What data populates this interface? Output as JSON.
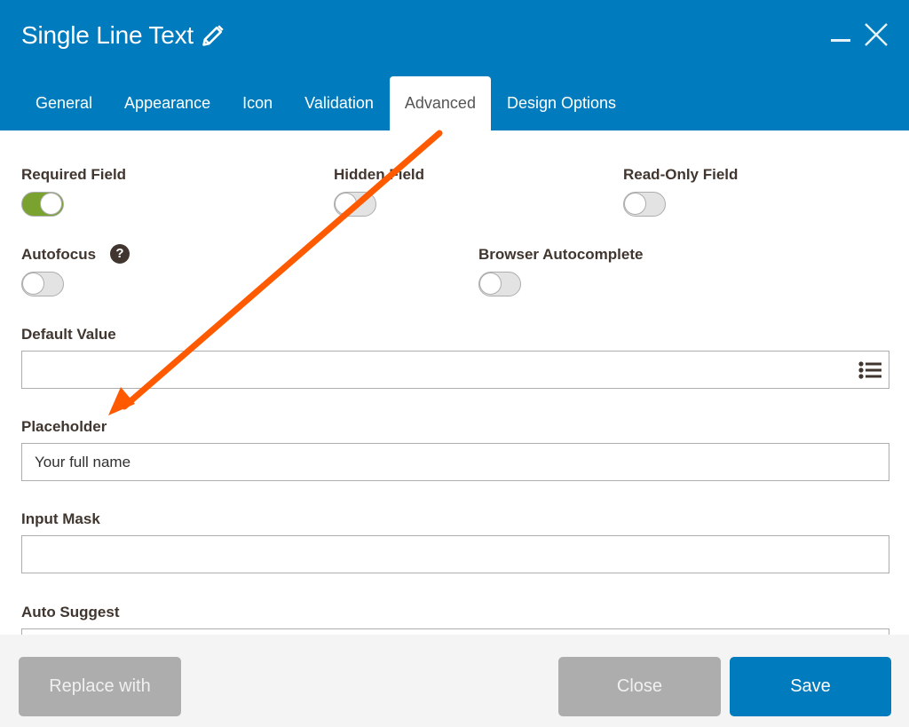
{
  "header": {
    "title": "Single Line Text",
    "edit_icon": "pencil-icon",
    "minimize_icon": "minimize-icon",
    "close_icon": "close-icon"
  },
  "tabs": [
    {
      "label": "General",
      "active": false
    },
    {
      "label": "Appearance",
      "active": false
    },
    {
      "label": "Icon",
      "active": false
    },
    {
      "label": "Validation",
      "active": false
    },
    {
      "label": "Advanced",
      "active": true
    },
    {
      "label": "Design Options",
      "active": false
    }
  ],
  "toggles": {
    "required_field": {
      "label": "Required Field",
      "on": true
    },
    "hidden_field": {
      "label": "Hidden Field",
      "on": false
    },
    "read_only_field": {
      "label": "Read-Only Field",
      "on": false
    },
    "autofocus": {
      "label": "Autofocus",
      "on": false,
      "help_icon": "question-circle-icon"
    },
    "browser_autocomplete": {
      "label": "Browser Autocomplete",
      "on": false
    }
  },
  "fields": {
    "default_value": {
      "label": "Default Value",
      "value": "",
      "icon": "list-icon"
    },
    "placeholder": {
      "label": "Placeholder",
      "value": "Your full name"
    },
    "input_mask": {
      "label": "Input Mask",
      "value": ""
    },
    "auto_suggest": {
      "label": "Auto Suggest",
      "value": ""
    }
  },
  "footer": {
    "replace_label": "Replace with",
    "close_label": "Close",
    "save_label": "Save"
  },
  "annotation": {
    "type": "arrow",
    "color": "#ff5a00",
    "from": "Advanced tab",
    "to": "Placeholder label"
  },
  "colors": {
    "brand": "#007bbd",
    "toggle_on": "#79a22e",
    "button_disabled": "#adadad"
  }
}
